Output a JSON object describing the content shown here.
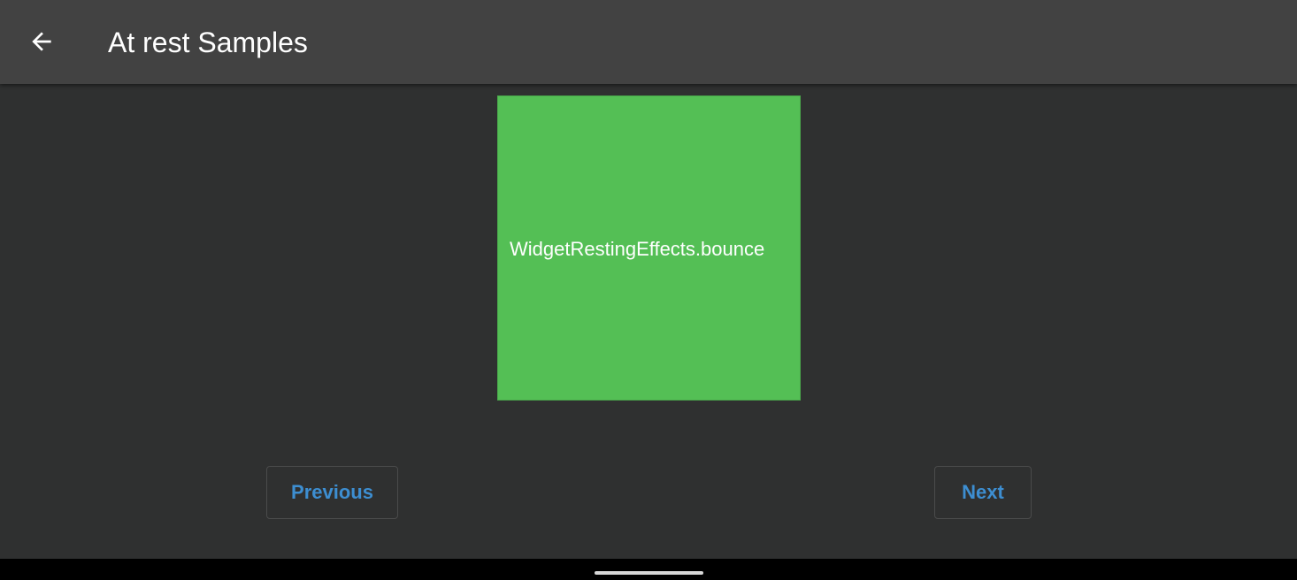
{
  "app_bar": {
    "title": "At rest Samples",
    "back_icon": "arrow-left-icon"
  },
  "sample": {
    "label": "WidgetRestingEffects.bounce",
    "color": "#54bf55"
  },
  "navigation": {
    "previous_label": "Previous",
    "next_label": "Next",
    "button_text_color": "#3d8ed1"
  },
  "colors": {
    "app_bar": "#424242",
    "background": "#2f3030"
  }
}
